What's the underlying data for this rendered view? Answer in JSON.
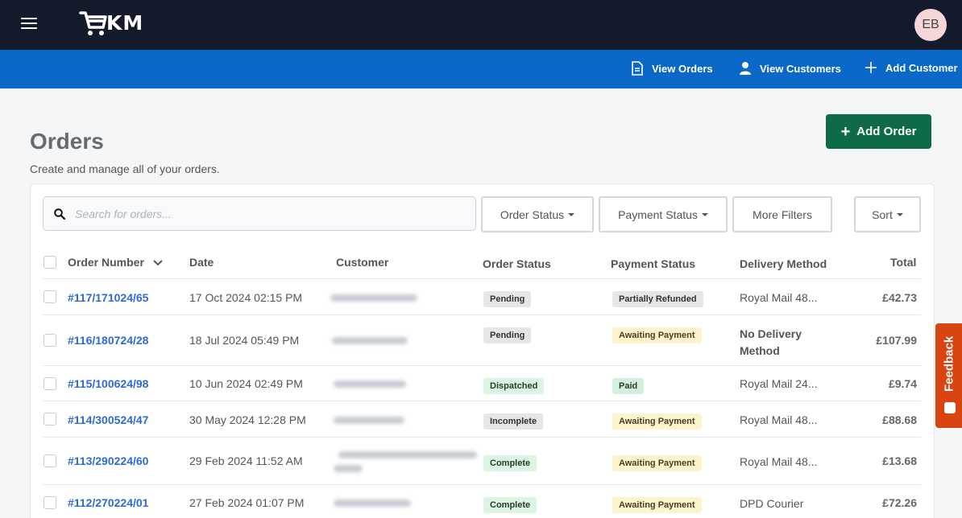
{
  "header": {
    "logo_text": "KM",
    "avatar_initials": "EB"
  },
  "subnav": {
    "view_orders": "View Orders",
    "view_customers": "View Customers",
    "add_customer": "Add Customer"
  },
  "page": {
    "title": "Orders",
    "subtitle": "Create and manage all of your orders.",
    "add_order_label": "Add Order"
  },
  "filters": {
    "search_placeholder": "Search for orders...",
    "order_status": "Order Status",
    "payment_status": "Payment Status",
    "more_filters": "More Filters",
    "sort": "Sort"
  },
  "table": {
    "columns": {
      "order_number": "Order Number",
      "date": "Date",
      "customer": "Customer",
      "order_status": "Order Status",
      "payment_status": "Payment Status",
      "delivery_method": "Delivery Method",
      "total": "Total"
    },
    "rows": [
      {
        "order": "#117/171024/65",
        "date": "17 Oct 2024 02:15 PM",
        "order_status": "Pending",
        "payment_status": "Partially Refunded",
        "delivery_1": "Royal Mail 48...",
        "delivery_2": "",
        "total": "£42.73"
      },
      {
        "order": "#116/180724/28",
        "date": "18 Jul 2024 05:49 PM",
        "order_status": "Pending",
        "payment_status": "Awaiting Payment",
        "delivery_1": "No Delivery",
        "delivery_2": "Method",
        "total": "£107.99"
      },
      {
        "order": "#115/100624/98",
        "date": "10 Jun 2024 02:49 PM",
        "order_status": "Dispatched",
        "payment_status": "Paid",
        "delivery_1": "Royal Mail 24...",
        "delivery_2": "",
        "total": "£9.74"
      },
      {
        "order": "#114/300524/47",
        "date": "30 May 2024 12:28 PM",
        "order_status": "Incomplete",
        "payment_status": "Awaiting Payment",
        "delivery_1": "Royal Mail 48...",
        "delivery_2": "",
        "total": "£88.68"
      },
      {
        "order": "#113/290224/60",
        "date": "29 Feb 2024 11:52 AM",
        "order_status": "Complete",
        "payment_status": "Awaiting Payment",
        "delivery_1": "Royal Mail 48...",
        "delivery_2": "",
        "total": "£13.68"
      },
      {
        "order": "#112/270224/01",
        "date": "27 Feb 2024 01:07 PM",
        "order_status": "Complete",
        "payment_status": "Awaiting Payment",
        "delivery_1": "DPD Courier",
        "delivery_2": "",
        "total": "£72.26"
      }
    ]
  },
  "feedback": {
    "label": "Feedback"
  },
  "colors": {
    "topbar": "#131a2c",
    "subbar": "#0a68c8",
    "primary_button": "#0d6b48",
    "link": "#2d6ad6",
    "feedback_tab": "#d84512"
  },
  "icons": [
    "hamburger-icon",
    "cart-logo-icon",
    "document-icon",
    "user-icon",
    "plus-icon",
    "search-icon",
    "chevron-down-icon",
    "feedback-icon"
  ]
}
